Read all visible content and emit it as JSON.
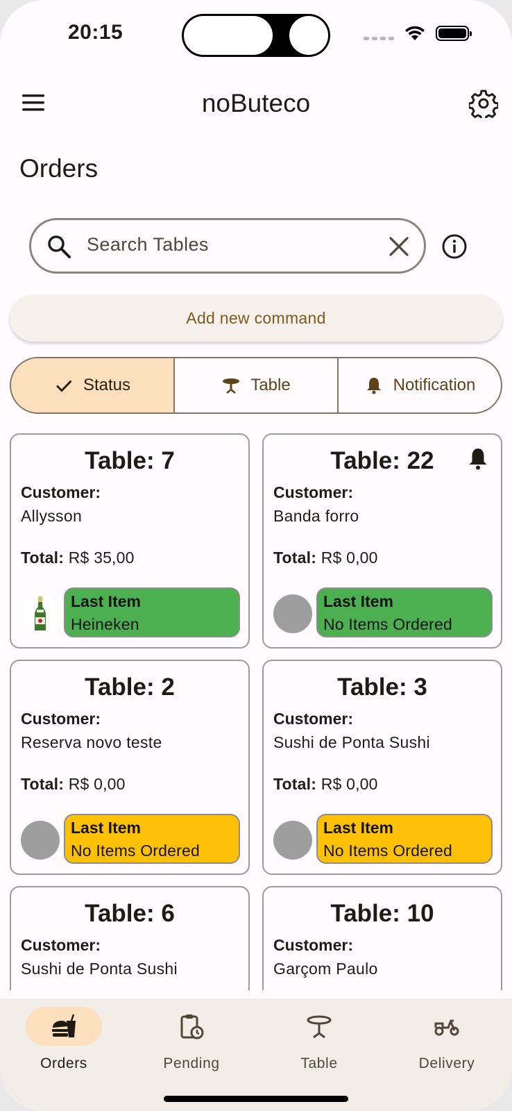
{
  "status_bar": {
    "time": "20:15"
  },
  "app_bar": {
    "title": "noButeco"
  },
  "page": {
    "title": "Orders"
  },
  "search": {
    "placeholder": "Search Tables"
  },
  "add_command": {
    "label": "Add new command"
  },
  "filters": [
    {
      "label": "Status",
      "icon": "check-icon",
      "active": true
    },
    {
      "label": "Table",
      "icon": "table-icon",
      "active": false
    },
    {
      "label": "Notification",
      "icon": "bell-icon",
      "active": false
    }
  ],
  "cards_common": {
    "customer_label": "Customer:",
    "total_label": "Total:",
    "last_item_label": "Last Item"
  },
  "cards": [
    {
      "title": "Table: 7",
      "customer": "Allysson",
      "total": "R$ 35,00",
      "last_item": "Heineken",
      "status_color": "#4caf50",
      "thumb": "beer-bottle",
      "notification": false
    },
    {
      "title": "Table: 22",
      "customer": "Banda forro",
      "total": "R$ 0,00",
      "last_item": "No Items Ordered",
      "status_color": "#4caf50",
      "thumb": "placeholder",
      "notification": true
    },
    {
      "title": "Table: 2",
      "customer": "Reserva novo teste",
      "total": "R$ 0,00",
      "last_item": "No Items Ordered",
      "status_color": "#ffc107",
      "thumb": "placeholder",
      "notification": false
    },
    {
      "title": "Table: 3",
      "customer": "Sushi de Ponta Sushi",
      "total": "R$ 0,00",
      "last_item": "No Items Ordered",
      "status_color": "#ffc107",
      "thumb": "placeholder",
      "notification": false
    },
    {
      "title": "Table: 6",
      "customer": "Sushi de Ponta Sushi"
    },
    {
      "title": "Table: 10",
      "customer": "Garçom Paulo"
    }
  ],
  "bottom_nav": [
    {
      "label": "Orders",
      "icon": "orders-icon",
      "active": true
    },
    {
      "label": "Pending",
      "icon": "pending-clipboard-icon",
      "active": false
    },
    {
      "label": "Table",
      "icon": "table-icon",
      "active": false
    },
    {
      "label": "Delivery",
      "icon": "delivery-scooter-icon",
      "active": false
    }
  ],
  "colors": {
    "accent": "#fcdfbd",
    "status_green": "#4caf50",
    "status_yellow": "#ffc107",
    "brand_text": "#7b5a1e"
  }
}
